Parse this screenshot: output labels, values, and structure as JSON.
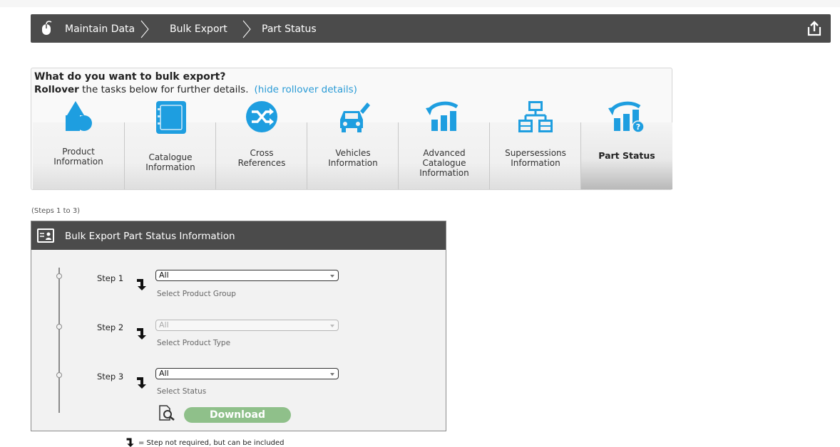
{
  "breadcrumbs": [
    {
      "label": "Maintain Data"
    },
    {
      "label": "Bulk Export"
    },
    {
      "label": "Part Status"
    }
  ],
  "task_panel": {
    "question": "What do you want to bulk export?",
    "rollover_bold": "Rollover",
    "rollover_rest": " the tasks below for further details.",
    "hide_link": "(hide rollover details)",
    "tiles": [
      {
        "label": "Product\nInformation",
        "icon": "shapes-icon"
      },
      {
        "label": "Catalogue\nInformation",
        "icon": "catalogue-book-icon"
      },
      {
        "label": "Cross\nReferences",
        "icon": "shuffle-icon"
      },
      {
        "label": "Vehicles\nInformation",
        "icon": "car-edit-icon"
      },
      {
        "label": "Advanced\nCatalogue\nInformation",
        "icon": "bar-chart-arrow-icon"
      },
      {
        "label": "Supersessions\nInformation",
        "icon": "hierarchy-icon"
      },
      {
        "label": "Part Status",
        "icon": "chart-status-icon",
        "active": true
      }
    ]
  },
  "steps_range": "(Steps 1 to 3)",
  "step_panel": {
    "title": "Bulk Export Part Status Information",
    "steps": [
      {
        "label": "Step 1",
        "value": "All",
        "hint": "Select Product Group",
        "disabled": false
      },
      {
        "label": "Step 2",
        "value": "All",
        "hint": "Select Product Type",
        "disabled": true
      },
      {
        "label": "Step 3",
        "value": "All",
        "hint": "Select Status",
        "disabled": false
      }
    ],
    "download_label": "Download"
  },
  "legend": "= Step not required, but can be included",
  "colors": {
    "header_bg": "#4b4b4b",
    "icon_blue": "#1e9ee0",
    "link": "#2a9bd6",
    "download": "#8fc08a"
  }
}
